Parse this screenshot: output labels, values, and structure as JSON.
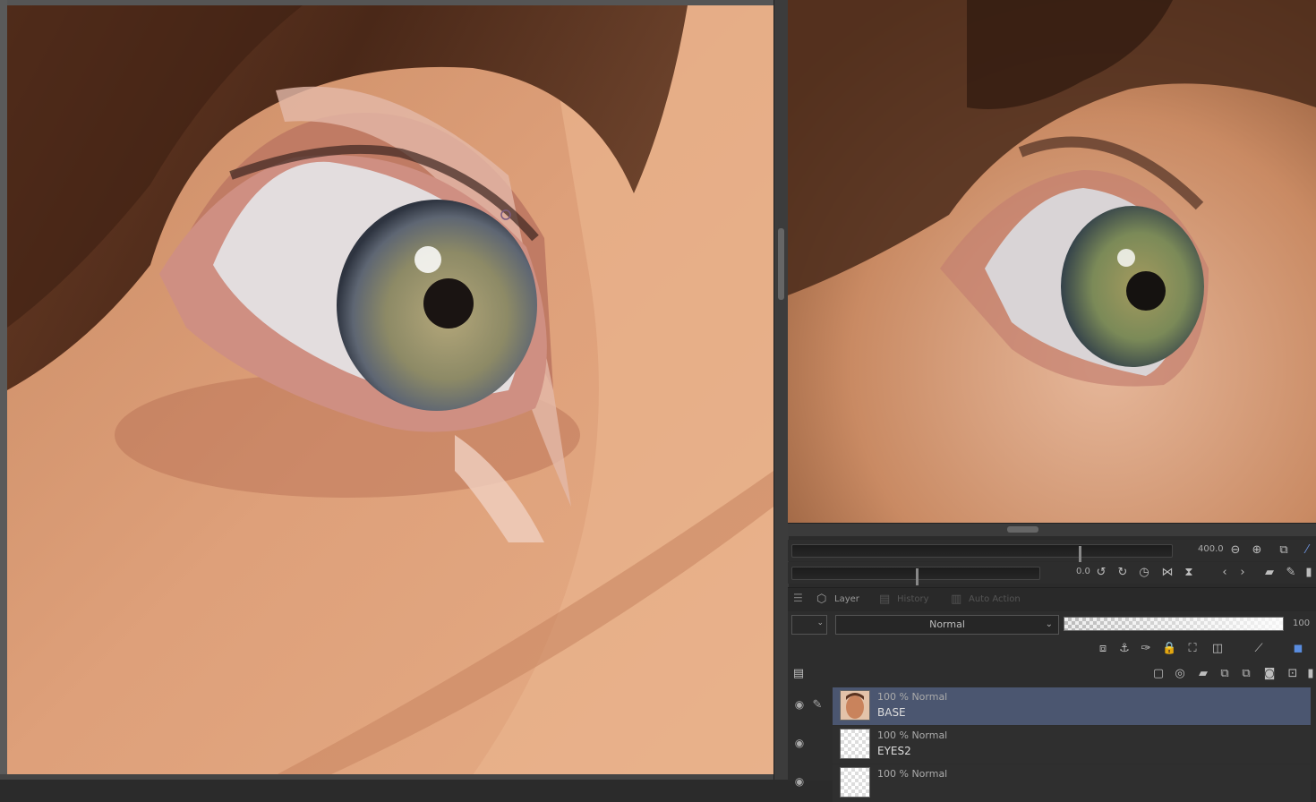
{
  "navigator": {
    "zoom_value": "400.0",
    "rotate_value": "0.0"
  },
  "layer_panel": {
    "tabs": [
      {
        "label": "Layer",
        "icon": "layer-icon",
        "active": true
      },
      {
        "label": "History",
        "icon": "history-icon",
        "active": false
      },
      {
        "label": "Auto Action",
        "icon": "auto-action-icon",
        "active": false
      }
    ],
    "blend_mode": "Normal",
    "opacity_value": "100",
    "layers": [
      {
        "mode": "100 % Normal",
        "name": "BASE",
        "selected": true
      },
      {
        "mode": "100 % Normal",
        "name": "EYES2",
        "selected": false
      },
      {
        "mode": "100 % Normal",
        "name": "",
        "selected": false
      }
    ]
  },
  "colors": {
    "selected_layer": "#4b5670",
    "panel_bg": "#2d2d2d",
    "skin": "#d79d7a",
    "hair": "#5a3320",
    "iris": "#8a8a63"
  }
}
